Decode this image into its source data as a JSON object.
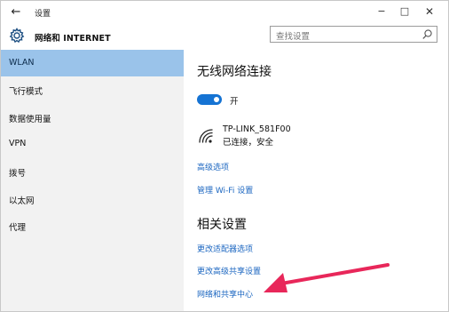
{
  "titlebar": {
    "back": "←",
    "title": "设置",
    "minimize": "−",
    "maximize": "□",
    "close": "✕"
  },
  "header": {
    "title": "网络和 INTERNET",
    "search_placeholder": "查找设置"
  },
  "sidebar": {
    "items": [
      {
        "label": "WLAN",
        "active": true
      },
      {
        "label": "飞行模式"
      },
      {
        "label": "数据使用量"
      },
      {
        "label": "VPN"
      },
      {
        "label": "拨号"
      },
      {
        "label": "以太网"
      },
      {
        "label": "代理"
      }
    ]
  },
  "main": {
    "wireless_title": "无线网络连接",
    "toggle_state_label": "开",
    "network": {
      "name": "TP-LINK_581F00",
      "status": "已连接，安全"
    },
    "advanced_link": "高级选项",
    "manage_link": "管理 Wi-Fi 设置",
    "related_title": "相关设置",
    "related_links": [
      "更改适配器选项",
      "更改高级共享设置",
      "网络和共享中心"
    ]
  },
  "colors": {
    "accent": "#1573d3",
    "link": "#1b66c0",
    "sidebar_active": "#9ac3ea",
    "annotation_arrow": "#e8275a"
  }
}
